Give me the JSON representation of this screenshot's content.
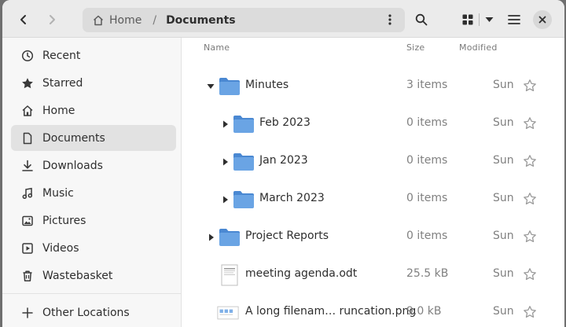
{
  "pathbar": {
    "home_label": "Home",
    "separator": "/",
    "current": "Documents"
  },
  "sidebar": {
    "items": [
      {
        "label": "Recent",
        "icon": "clock-icon"
      },
      {
        "label": "Starred",
        "icon": "star-icon"
      },
      {
        "label": "Home",
        "icon": "home-icon"
      },
      {
        "label": "Documents",
        "icon": "document-icon",
        "active": true
      },
      {
        "label": "Downloads",
        "icon": "download-icon"
      },
      {
        "label": "Music",
        "icon": "music-icon"
      },
      {
        "label": "Pictures",
        "icon": "picture-icon"
      },
      {
        "label": "Videos",
        "icon": "video-icon"
      },
      {
        "label": "Wastebasket",
        "icon": "trash-icon"
      }
    ],
    "other": {
      "label": "Other Locations",
      "icon": "plus-icon"
    }
  },
  "columns": {
    "name": "Name",
    "size": "Size",
    "modified": "Modified"
  },
  "files": [
    {
      "name": "Minutes",
      "size": "3 items",
      "modified": "Sun",
      "type": "folder",
      "expanded": true
    },
    {
      "name": "Feb 2023",
      "size": "0 items",
      "modified": "Sun",
      "type": "folder"
    },
    {
      "name": "Jan 2023",
      "size": "0 items",
      "modified": "Sun",
      "type": "folder"
    },
    {
      "name": "March 2023",
      "size": "0 items",
      "modified": "Sun",
      "type": "folder"
    },
    {
      "name": "Project Reports",
      "size": "0 items",
      "modified": "Sun",
      "type": "folder"
    },
    {
      "name": "meeting agenda.odt",
      "size": "25.5 kB",
      "modified": "Sun",
      "type": "document"
    },
    {
      "name": "A long filenam… runcation.png",
      "size": "9.0 kB",
      "modified": "Sun",
      "type": "image"
    }
  ],
  "colors": {
    "folder": "#6aa4e4",
    "folder_tab": "#4a88d2",
    "sidebar_active": "#e2e2e2",
    "headerbar": "#ebebeb"
  }
}
